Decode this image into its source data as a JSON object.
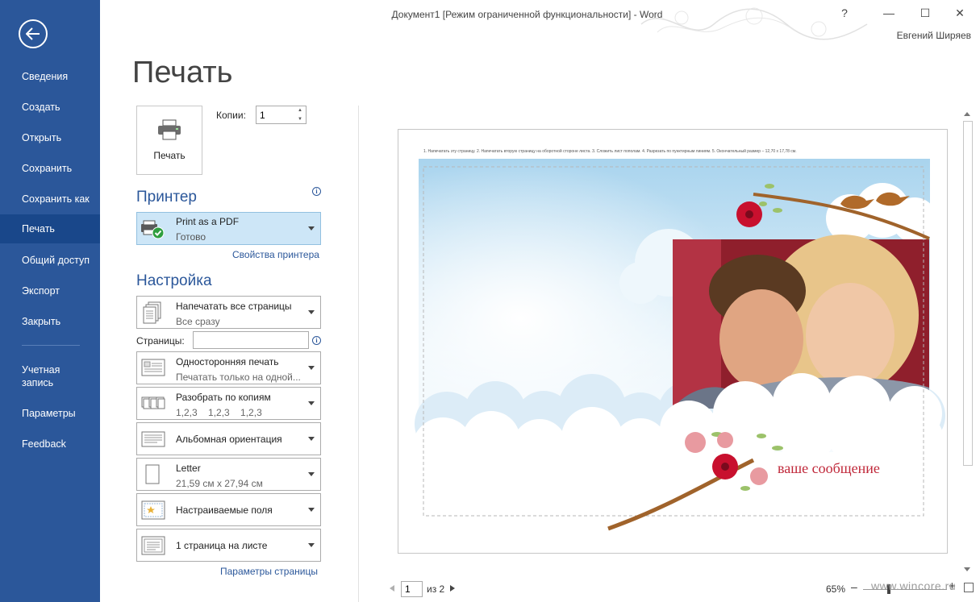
{
  "window": {
    "title": "Документ1 [Режим ограниченной функциональности] - Word",
    "user": "Евгений Ширяев",
    "help": "?",
    "minimize": "—",
    "maximize": "☐",
    "close": "✕"
  },
  "sidebar": {
    "items": [
      {
        "label": "Сведения"
      },
      {
        "label": "Создать"
      },
      {
        "label": "Открыть"
      },
      {
        "label": "Сохранить"
      },
      {
        "label": "Сохранить как"
      },
      {
        "label": "Печать"
      },
      {
        "label": "Общий доступ"
      },
      {
        "label": "Экспорт"
      },
      {
        "label": "Закрыть"
      },
      {
        "label": "Учетная запись"
      },
      {
        "label": "Параметры"
      },
      {
        "label": "Feedback"
      }
    ],
    "active": "Печать"
  },
  "print": {
    "page_title": "Печать",
    "button_label": "Печать",
    "copies_label": "Копии:",
    "copies_value": "1"
  },
  "printer": {
    "section_title": "Принтер",
    "name": "Print as a PDF",
    "status": "Готово",
    "properties_link": "Свойства принтера"
  },
  "settings": {
    "section_title": "Настройка",
    "print_range": {
      "title": "Напечатать все страницы",
      "subtitle": "Все сразу"
    },
    "pages_label": "Страницы:",
    "pages_value": "",
    "sides": {
      "title": "Односторонняя печать",
      "subtitle": "Печатать только на одной..."
    },
    "collate": {
      "title": "Разобрать по копиям",
      "subtitle": "1,2,3    1,2,3    1,2,3"
    },
    "orientation": {
      "title": "Альбомная ориентация"
    },
    "paper": {
      "title": "Letter",
      "subtitle": "21,59 см x 27,94 см"
    },
    "margins": {
      "title": "Настраиваемые поля"
    },
    "per_sheet": {
      "title": "1 страница на листе"
    },
    "page_setup_link": "Параметры страницы"
  },
  "preview": {
    "instructions": "1. Напечатать эту страницу.   2. Напечатать вторую страницу на оборотной стороне листа.   3. Сложить лист пополам.   4. Разрезать по пунктирным линиям.   5. Окончательный размер – 12,70 x 17,78 см.",
    "message": "ваше сообщение",
    "message_color": "#c0283a"
  },
  "pager": {
    "current": "1",
    "of_label": "из 2"
  },
  "zoom": {
    "percent_label": "65%",
    "minus": "–",
    "plus": "+"
  },
  "watermark": "www.wincore.ru",
  "colors": {
    "accent": "#2b579a",
    "accent_dark": "#19478a",
    "printer_selected": "#cde6f7"
  }
}
